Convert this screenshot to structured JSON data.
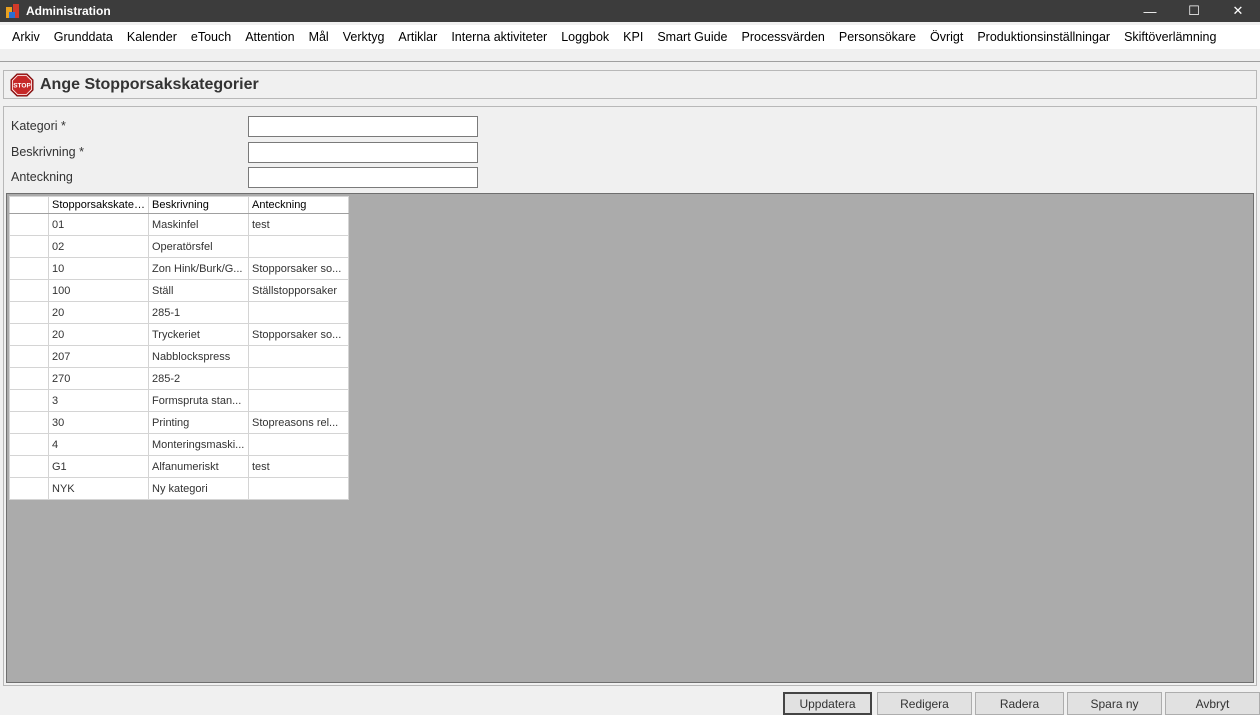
{
  "window": {
    "title": "Administration",
    "minimize": "—",
    "maximize": "☐",
    "close": "✕"
  },
  "menu": [
    "Arkiv",
    "Grunddata",
    "Kalender",
    "eTouch",
    "Attention",
    "Mål",
    "Verktyg",
    "Artiklar",
    "Interna aktiviteter",
    "Loggbok",
    "KPI",
    "Smart Guide",
    "Processvärden",
    "Personsökare",
    "Övrigt",
    "Produktionsinställningar",
    "Skiftöverlämning"
  ],
  "page": {
    "title": "Ange Stopporsakskategorier",
    "stop_icon_text": "STOP"
  },
  "form": {
    "kategori_label": "Kategori *",
    "beskrivning_label": "Beskrivning *",
    "anteckning_label": "Anteckning",
    "kategori_value": "",
    "beskrivning_value": "",
    "anteckning_value": ""
  },
  "grid": {
    "columns": [
      "Stopporsakskatego",
      "Beskrivning",
      "Anteckning"
    ],
    "rows": [
      [
        "01",
        "Maskinfel",
        "test"
      ],
      [
        "02",
        "Operatörsfel",
        ""
      ],
      [
        "10",
        "Zon Hink/Burk/G...",
        "Stopporsaker so..."
      ],
      [
        "100",
        "Ställ",
        "Ställstopporsaker"
      ],
      [
        "20",
        "285-1",
        ""
      ],
      [
        "20",
        "Tryckeriet",
        "Stopporsaker so..."
      ],
      [
        "207",
        "Nabblockspress",
        ""
      ],
      [
        "270",
        "285-2",
        ""
      ],
      [
        "3",
        "Formspruta stan...",
        ""
      ],
      [
        "30",
        "Printing",
        "Stopreasons rel..."
      ],
      [
        "4",
        "Monteringsmaski...",
        ""
      ],
      [
        "G1",
        "Alfanumeriskt",
        "test"
      ],
      [
        "NYK",
        "Ny kategori",
        ""
      ]
    ]
  },
  "buttons": {
    "update": "Uppdatera",
    "edit": "Redigera",
    "delete": "Radera",
    "save_new": "Spara ny",
    "cancel": "Avbryt"
  }
}
